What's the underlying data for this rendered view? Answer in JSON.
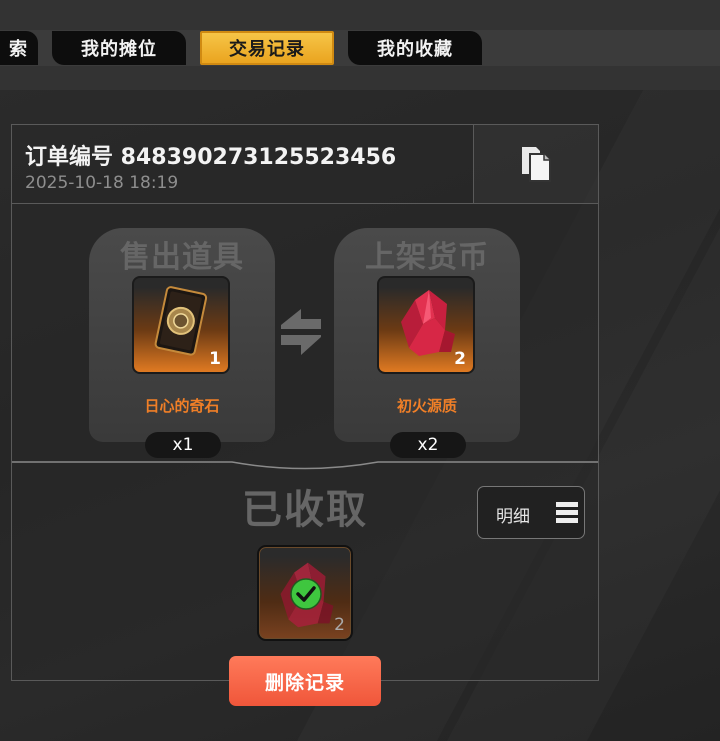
{
  "tabs": [
    {
      "label": "索"
    },
    {
      "label": "我的摊位"
    },
    {
      "label": "交易记录",
      "active": true
    },
    {
      "label": "我的收藏"
    }
  ],
  "order": {
    "id_text": "订单编号 848390273125523456",
    "time": "2025-10-18 18:19",
    "copy_icon": "copy-icon"
  },
  "sold": {
    "title": "售出道具",
    "item_name": "日心的奇石",
    "item_qty": "1",
    "count": "x1",
    "icon": "sun-stone-card-icon"
  },
  "listed": {
    "title": "上架货币",
    "item_name": "初火源质",
    "item_qty": "2",
    "count": "x2",
    "icon": "red-crystal-icon"
  },
  "status": {
    "text": "已收取",
    "detail_label": "明细",
    "detail_icon": "list-menu-icon"
  },
  "reward": {
    "qty": "2",
    "icon": "red-crystal-icon",
    "check_icon": "check-badge-icon"
  },
  "actions": {
    "delete_label": "删除记录"
  },
  "colors": {
    "active_tab": "#f0b334",
    "item_name": "#f07f27",
    "delete_button": "#f25e40"
  }
}
